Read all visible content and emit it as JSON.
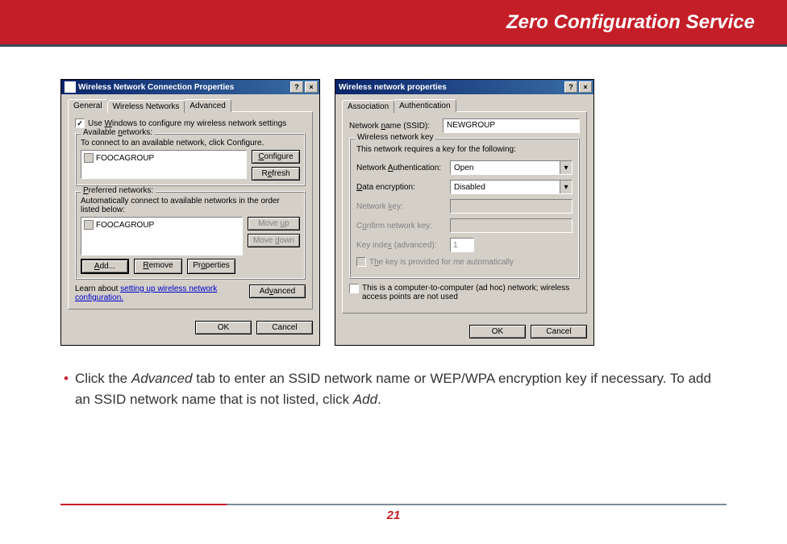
{
  "header": {
    "title": "Zero Configuration Service"
  },
  "page_number": "21",
  "dialog1": {
    "title": "Wireless Network Connection Properties",
    "help_btn": "?",
    "close_btn": "×",
    "tabs": {
      "general": "General",
      "wireless": "Wireless Networks",
      "advanced": "Advanced"
    },
    "use_windows": "Use Windows to configure my wireless network settings",
    "available": {
      "legend": "Available networks:",
      "hint": "To connect to an available network, click Configure.",
      "item": "FOOCAGROUP",
      "configure": "Configure",
      "refresh": "Refresh"
    },
    "preferred": {
      "legend": "Preferred networks:",
      "hint": "Automatically connect to available networks in the order listed below:",
      "item": "FOOCAGROUP",
      "move_up": "Move up",
      "move_down": "Move down",
      "add": "Add...",
      "remove": "Remove",
      "properties": "Properties"
    },
    "learn1": "Learn about ",
    "learn_link": "setting up wireless network configuration.",
    "advanced_btn": "Advanced",
    "ok": "OK",
    "cancel": "Cancel"
  },
  "dialog2": {
    "title": "Wireless network properties",
    "help_btn": "?",
    "close_btn": "×",
    "tabs": {
      "association": "Association",
      "authentication": "Authentication"
    },
    "ssid_label": "Network name (SSID):",
    "ssid_value": "NEWGROUP",
    "key": {
      "legend": "Wireless network key",
      "hint": "This network requires a key for the following:",
      "auth_label": "Network Authentication:",
      "auth_value": "Open",
      "enc_label": "Data encryption:",
      "enc_value": "Disabled",
      "netkey_label": "Network key:",
      "confirm_label": "Confirm network key:",
      "idx_label": "Key index (advanced):",
      "idx_value": "1",
      "auto_label": "The key is provided for me automatically"
    },
    "adhoc": "This is a computer-to-computer (ad hoc) network; wireless access points are not used",
    "ok": "OK",
    "cancel": "Cancel"
  },
  "instruction": {
    "bullet": "•",
    "pre": "Click the ",
    "em1": "Advanced",
    "mid": " tab to enter an SSID network name or WEP/WPA encryption key if necessary.  To add an SSID network name that is not listed, click ",
    "em2": "Add",
    "post": "."
  }
}
